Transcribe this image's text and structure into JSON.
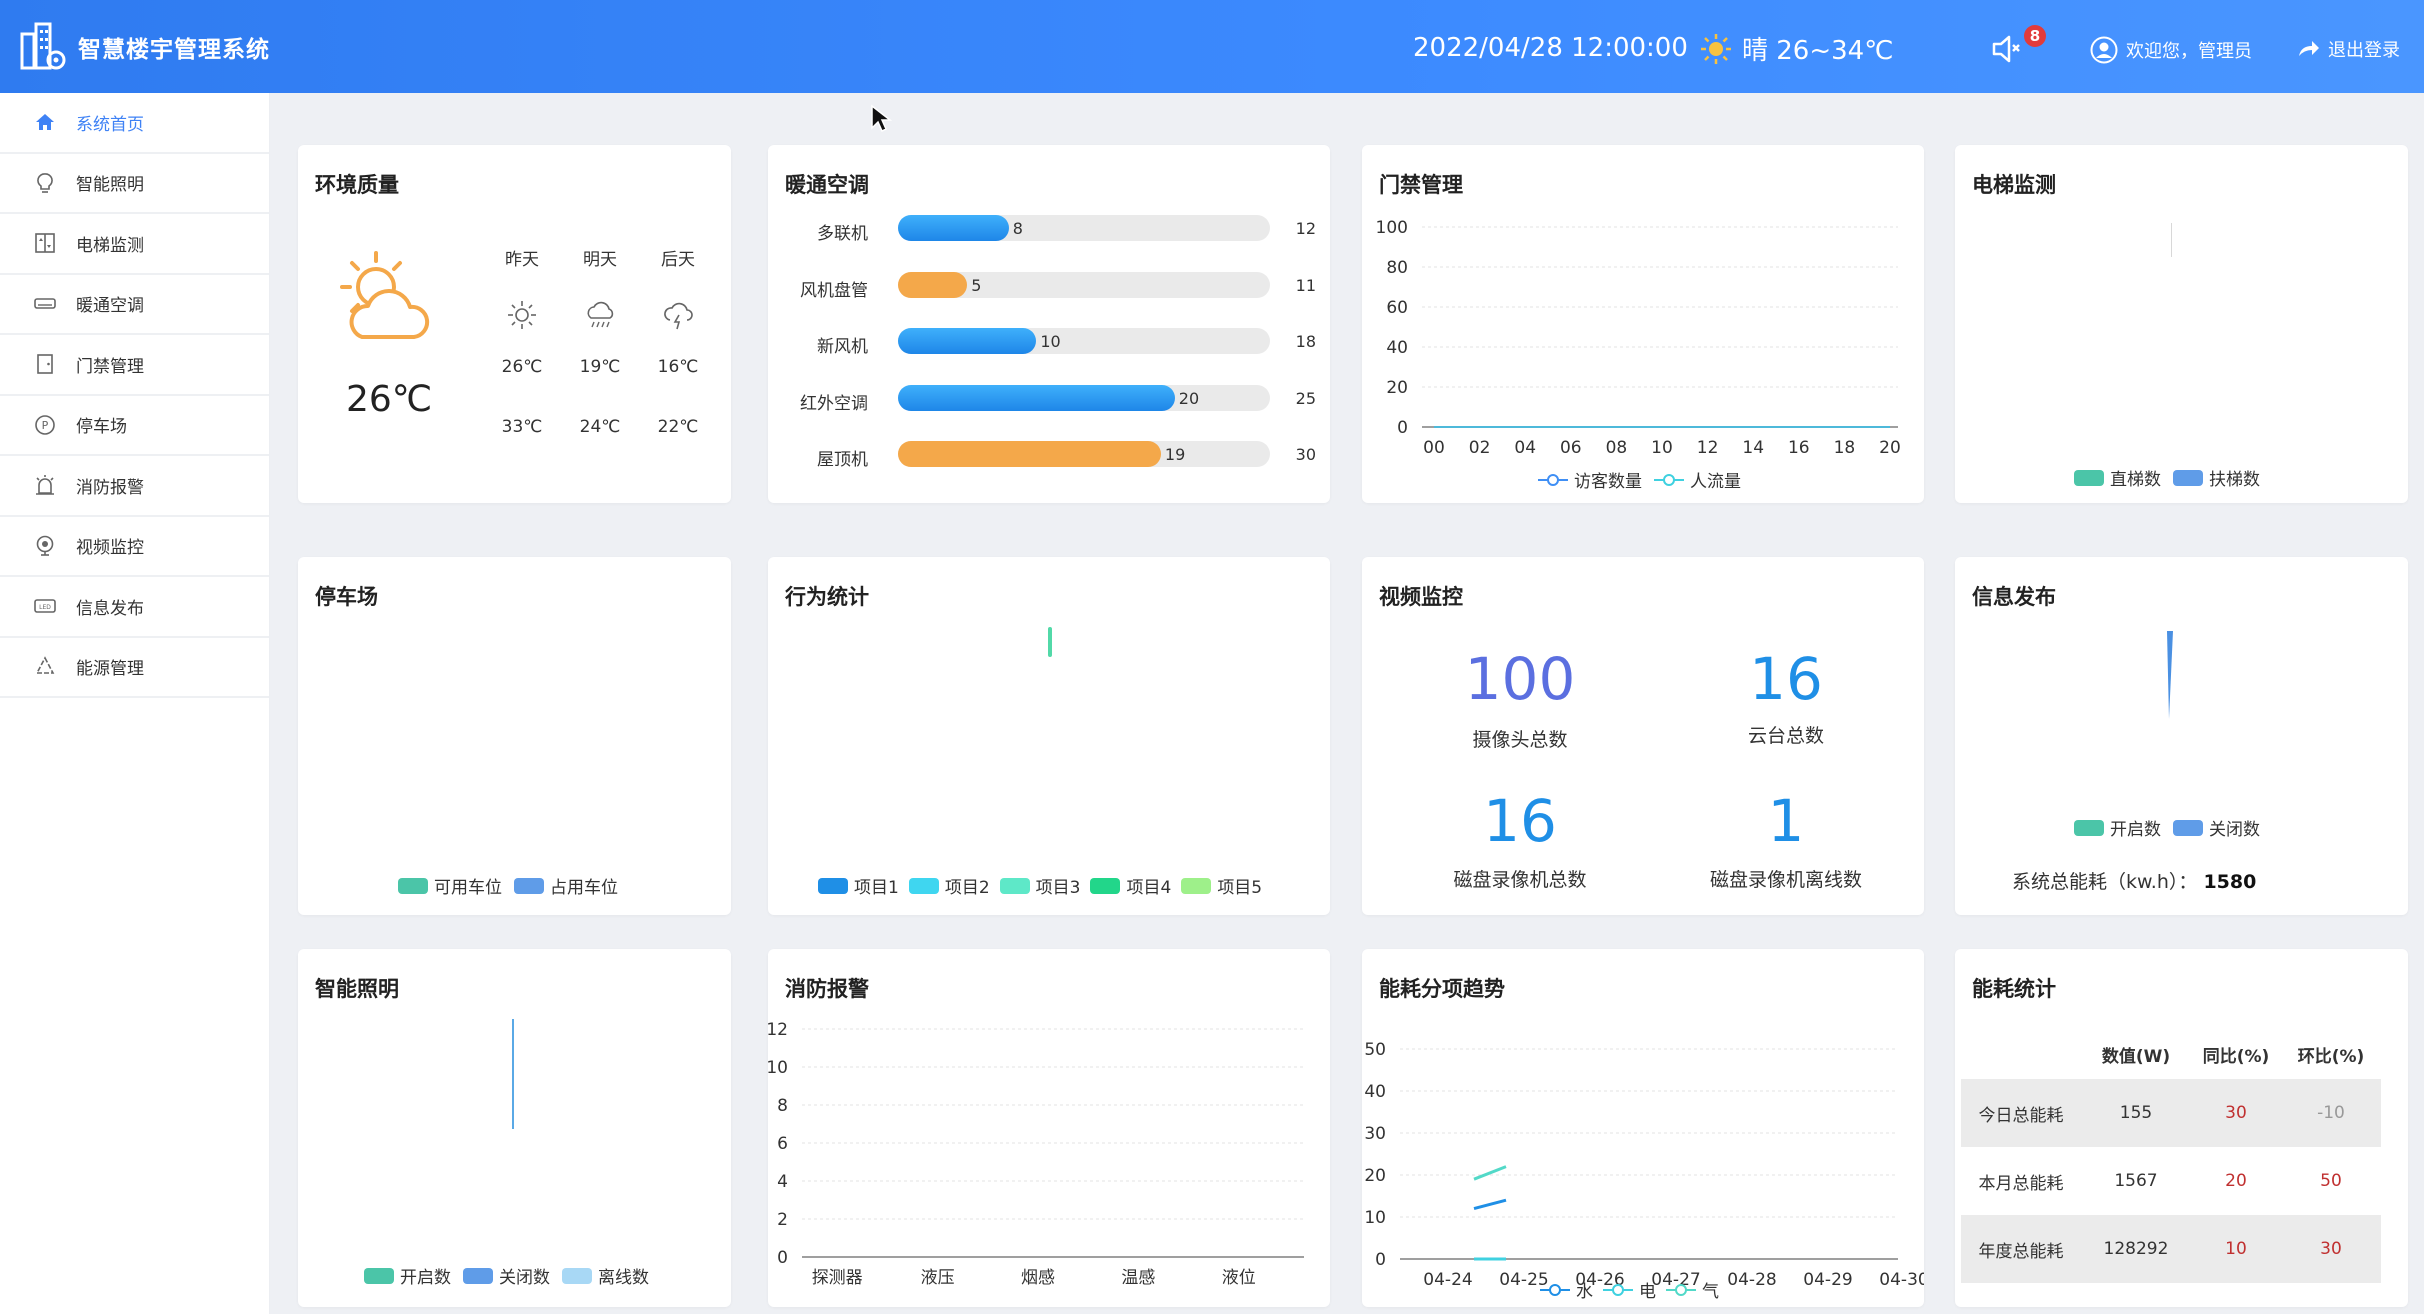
{
  "header": {
    "app_title": "智慧楼宇管理系统",
    "datetime": "2022/04/28 12:00:00",
    "weather": "晴 26~34℃",
    "notification_count": "8",
    "welcome": "欢迎您，管理员",
    "logout": "退出登录"
  },
  "sidebar": {
    "items": [
      {
        "label": "系统首页",
        "icon": "home-icon"
      },
      {
        "label": "智能照明",
        "icon": "bulb-icon"
      },
      {
        "label": "电梯监测",
        "icon": "elevator-icon"
      },
      {
        "label": "暖通空调",
        "icon": "aircon-icon"
      },
      {
        "label": "门禁管理",
        "icon": "door-icon"
      },
      {
        "label": "停车场",
        "icon": "parking-icon"
      },
      {
        "label": "消防报警",
        "icon": "alarm-icon"
      },
      {
        "label": "视频监控",
        "icon": "camera-icon"
      },
      {
        "label": "信息发布",
        "icon": "led-icon"
      },
      {
        "label": "能源管理",
        "icon": "recycle-icon"
      }
    ]
  },
  "environment": {
    "title": "环境质量",
    "current_temp": "26℃",
    "days": [
      {
        "label": "昨天",
        "low": "26℃",
        "high": "33℃",
        "icon": "sun-icon"
      },
      {
        "label": "明天",
        "low": "19℃",
        "high": "24℃",
        "icon": "rain-icon"
      },
      {
        "label": "后天",
        "low": "16℃",
        "high": "22℃",
        "icon": "thunder-icon"
      }
    ]
  },
  "hvac": {
    "title": "暖通空调",
    "rows": [
      {
        "label": "多联机",
        "value": 8,
        "max": 12,
        "color": "#2f9bf0"
      },
      {
        "label": "风机盘管",
        "value": 5,
        "max": 11,
        "color": "#f4a84a"
      },
      {
        "label": "新风机",
        "value": 10,
        "max": 18,
        "color": "#2f9bf0"
      },
      {
        "label": "红外空调",
        "value": 20,
        "max": 25,
        "color": "#2f9bf0"
      },
      {
        "label": "屋顶机",
        "value": 19,
        "max": 30,
        "color": "#f4a84a"
      }
    ]
  },
  "access": {
    "title": "门禁管理",
    "legend": [
      "访客数量",
      "人流量"
    ]
  },
  "elevator": {
    "title": "电梯监测",
    "legend": [
      "直梯数",
      "扶梯数"
    ]
  },
  "parking": {
    "title": "停车场",
    "legend": [
      "可用车位",
      "占用车位"
    ]
  },
  "behavior": {
    "title": "行为统计",
    "legend": [
      "项目1",
      "项目2",
      "项目3",
      "项目4",
      "项目5"
    ]
  },
  "video": {
    "title": "视频监控",
    "stats": [
      {
        "value": "100",
        "label": "摄像头总数"
      },
      {
        "value": "16",
        "label": "云台总数"
      },
      {
        "value": "16",
        "label": "磁盘录像机总数"
      },
      {
        "value": "1",
        "label": "磁盘录像机离线数"
      }
    ]
  },
  "info": {
    "title": "信息发布",
    "legend": [
      "开启数",
      "关闭数"
    ],
    "energy_label": "系统总能耗（kw.h）：",
    "energy_value": "1580"
  },
  "lighting": {
    "title": "智能照明",
    "legend": [
      "开启数",
      "关闭数",
      "离线数"
    ]
  },
  "fire": {
    "title": "消防报警"
  },
  "trend": {
    "title": "能耗分项趋势",
    "legend": [
      "水",
      "电",
      "气"
    ]
  },
  "energy_stats": {
    "title": "能耗统计",
    "headers": [
      "",
      "数值(W)",
      "同比(%)",
      "环比(%)"
    ],
    "rows": [
      {
        "label": "今日总能耗",
        "value": "155",
        "yoy": "30",
        "mom": "-10"
      },
      {
        "label": "本月总能耗",
        "value": "1567",
        "yoy": "20",
        "mom": "50"
      },
      {
        "label": "年度总能耗",
        "value": "128292",
        "yoy": "10",
        "mom": "30"
      }
    ]
  },
  "chart_data": [
    {
      "type": "bar",
      "title": "暖通空调",
      "categories": [
        "多联机",
        "风机盘管",
        "新风机",
        "红外空调",
        "屋顶机"
      ],
      "series": [
        {
          "values": [
            8,
            5,
            10,
            20,
            19
          ]
        }
      ],
      "max_values": [
        12,
        11,
        18,
        25,
        30
      ]
    },
    {
      "type": "line",
      "title": "门禁管理",
      "x": [
        "00",
        "02",
        "04",
        "06",
        "08",
        "10",
        "12",
        "14",
        "16",
        "18",
        "20"
      ],
      "ylim": [
        0,
        100
      ],
      "yticks": [
        0,
        20,
        40,
        60,
        80,
        100
      ],
      "series": [
        {
          "name": "访客数量",
          "values": [
            0,
            0,
            0,
            0,
            0,
            0,
            0,
            0,
            0,
            0,
            0
          ]
        },
        {
          "name": "人流量",
          "values": [
            0,
            0,
            0,
            0,
            0,
            0,
            0,
            0,
            0,
            0,
            0
          ]
        }
      ],
      "legend_position": "bottom",
      "colors": [
        "#3f8ff5",
        "#3fd1e0"
      ]
    },
    {
      "type": "bar",
      "title": "消防报警",
      "categories": [
        "探测器",
        "液压",
        "烟感",
        "温感",
        "液位"
      ],
      "ylim": [
        0,
        12
      ],
      "yticks": [
        0,
        2,
        4,
        6,
        8,
        10,
        12
      ],
      "series": [
        {
          "values": [
            0,
            0,
            0,
            0,
            0
          ]
        }
      ]
    },
    {
      "type": "line",
      "title": "能耗分项趋势",
      "x": [
        "04-24",
        "04-25",
        "04-26",
        "04-27",
        "04-28",
        "04-29",
        "04-30"
      ],
      "ylim": [
        0,
        50
      ],
      "yticks": [
        0,
        10,
        20,
        30,
        40,
        50
      ],
      "series": [
        {
          "name": "水",
          "values": [
            12,
            14
          ]
        },
        {
          "name": "电",
          "values": [
            0,
            0
          ]
        },
        {
          "name": "气",
          "values": [
            19,
            22
          ]
        }
      ],
      "legend_position": "bottom",
      "colors": [
        "#1f8fe6",
        "#3fd1e0",
        "#52d9c8"
      ]
    }
  ]
}
